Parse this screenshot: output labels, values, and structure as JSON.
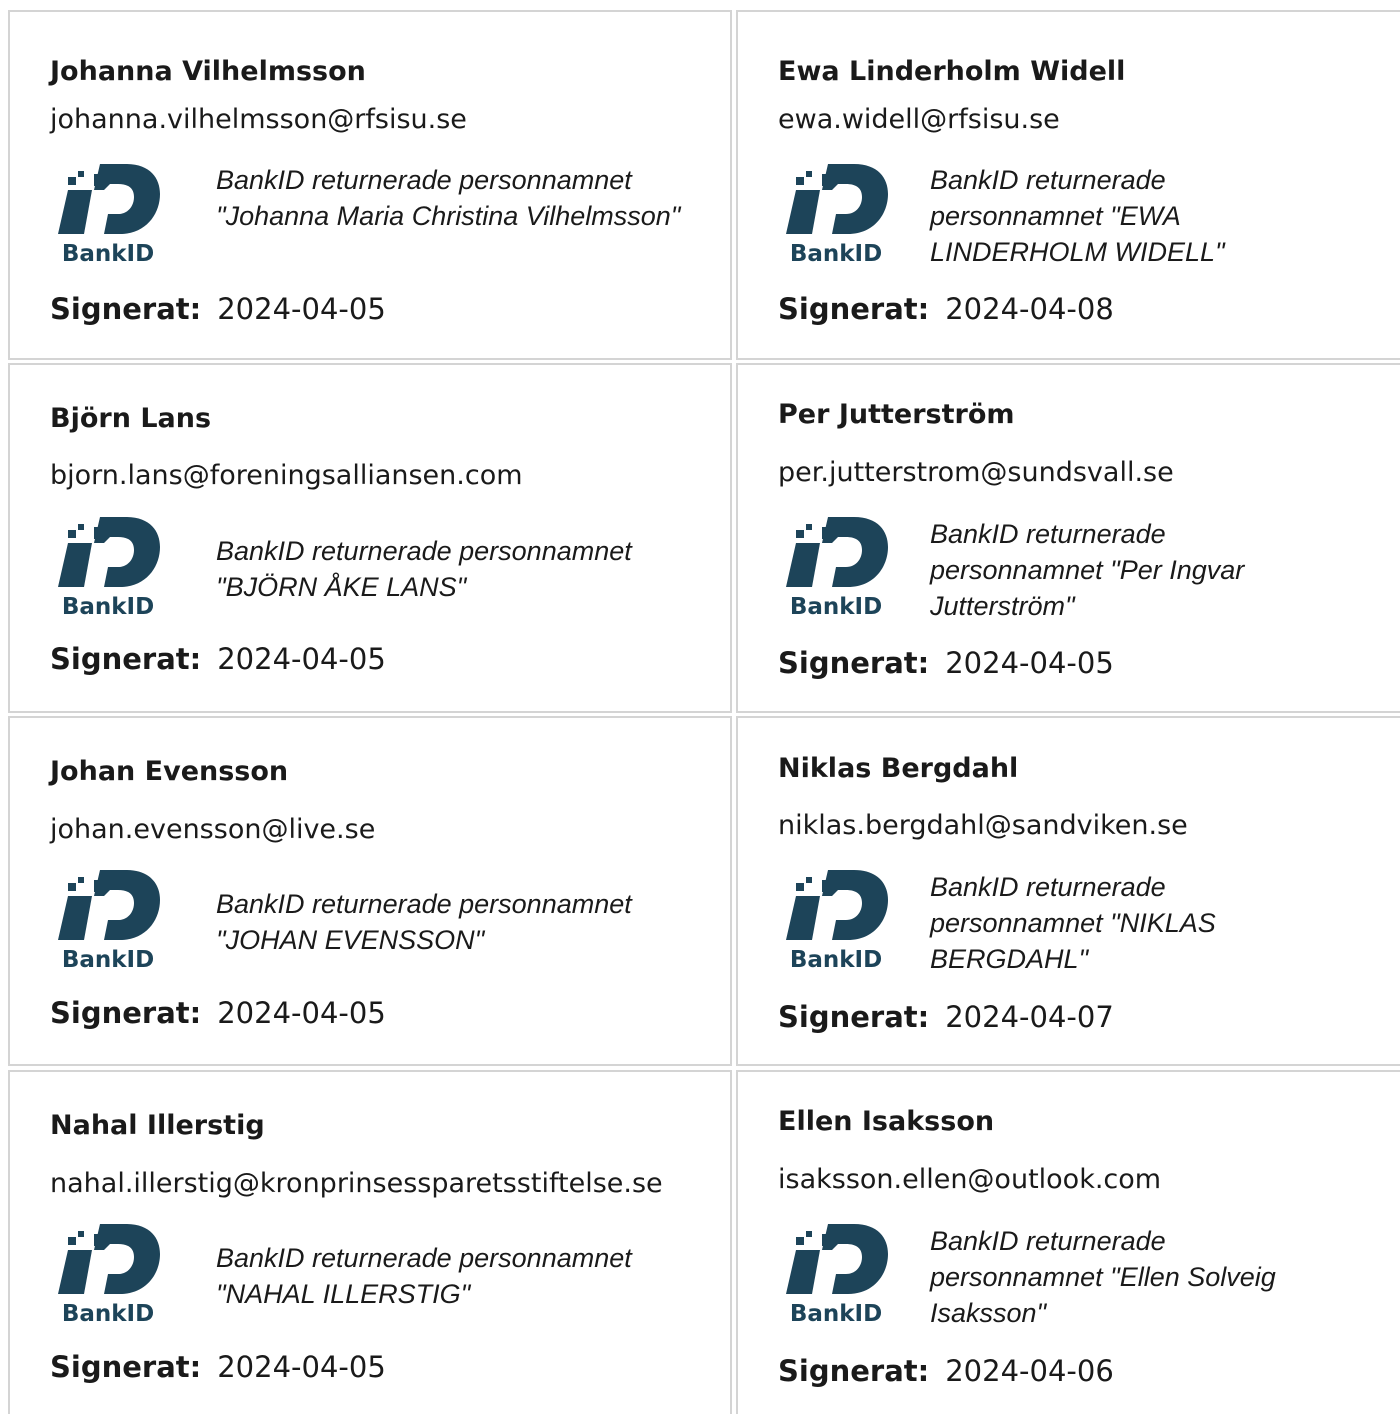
{
  "signatures": [
    {
      "name": "Johanna Vilhelmsson",
      "email": "johanna.vilhelmsson@rfsisu.se",
      "bankid_text": "BankID returnerade personnamnet \"Johanna Maria Christina Vilhelmsson\"",
      "signed_label": "Signerat:",
      "signed_date": "2024-04-05"
    },
    {
      "name": "Ewa Linderholm Widell",
      "email": "ewa.widell@rfsisu.se",
      "bankid_text": "BankID returnerade personnamnet \"EWA LINDERHOLM WIDELL\"",
      "signed_label": "Signerat:",
      "signed_date": "2024-04-08"
    },
    {
      "name": "Björn Lans",
      "email": "bjorn.lans@foreningsalliansen.com",
      "bankid_text": "BankID returnerade personnamnet \"BJÖRN ÅKE LANS\"",
      "signed_label": "Signerat:",
      "signed_date": "2024-04-05"
    },
    {
      "name": "Per Jutterström",
      "email": "per.jutterstrom@sundsvall.se",
      "bankid_text": "BankID returnerade personnamnet \"Per Ingvar Jutterström\"",
      "signed_label": "Signerat:",
      "signed_date": "2024-04-05"
    },
    {
      "name": "Johan Evensson",
      "email": "johan.evensson@live.se",
      "bankid_text": "BankID returnerade personnamnet \"JOHAN EVENSSON\"",
      "signed_label": "Signerat:",
      "signed_date": "2024-04-05"
    },
    {
      "name": "Niklas Bergdahl",
      "email": "niklas.bergdahl@sandviken.se",
      "bankid_text": "BankID returnerade personnamnet \"NIKLAS BERGDAHL\"",
      "signed_label": "Signerat:",
      "signed_date": "2024-04-07"
    },
    {
      "name": "Nahal Illerstig",
      "email": "nahal.illerstig@kronprinsessparetsstiftelse.se",
      "bankid_text": "BankID returnerade personnamnet \"NAHAL ILLERSTIG\"",
      "signed_label": "Signerat:",
      "signed_date": "2024-04-05"
    },
    {
      "name": "Ellen Isaksson",
      "email": "isaksson.ellen@outlook.com",
      "bankid_text": "BankID returnerade personnamnet \"Ellen Solveig Isaksson\"",
      "signed_label": "Signerat:",
      "signed_date": "2024-04-06"
    }
  ],
  "logo": {
    "wordmark": "BankID",
    "color": "#1d4459"
  },
  "colors": {
    "border": "#d4d4d4",
    "text": "#1a1a1a"
  }
}
